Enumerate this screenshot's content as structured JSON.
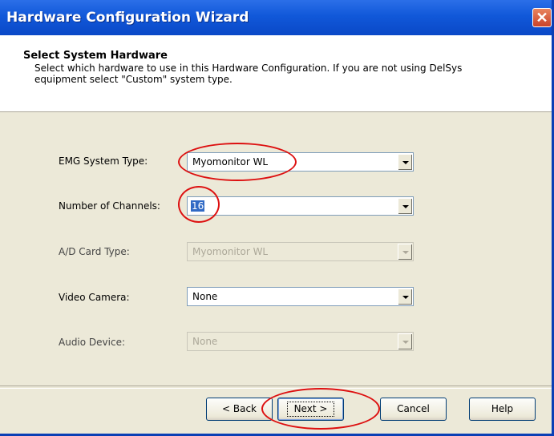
{
  "window": {
    "title": "Hardware Configuration Wizard",
    "close_glyph": "✕"
  },
  "header": {
    "title": "Select System Hardware",
    "description": "Select which hardware to use in this Hardware Configuration. If you are not using DelSys equipment select \"Custom\" system type."
  },
  "fields": {
    "emg_system_type": {
      "label": "EMG System Type:",
      "value": "Myomonitor WL",
      "enabled": true
    },
    "number_of_channels": {
      "label": "Number of Channels:",
      "value": "16",
      "enabled": true
    },
    "ad_card_type": {
      "label": "A/D Card Type:",
      "value": "Myomonitor WL",
      "enabled": false
    },
    "video_camera": {
      "label": "Video Camera:",
      "value": "None",
      "enabled": true
    },
    "audio_device": {
      "label": "Audio Device:",
      "value": "None",
      "enabled": false
    }
  },
  "buttons": {
    "back_label": "< Back",
    "next_label": "Next >",
    "cancel_label": "Cancel",
    "help_label": "Help"
  },
  "annotation": {
    "ellipse_color": "#dd1010"
  },
  "colors": {
    "titlebar": "#1158d9",
    "dialog_bg": "#ece9d8",
    "selection": "#316ac5"
  }
}
